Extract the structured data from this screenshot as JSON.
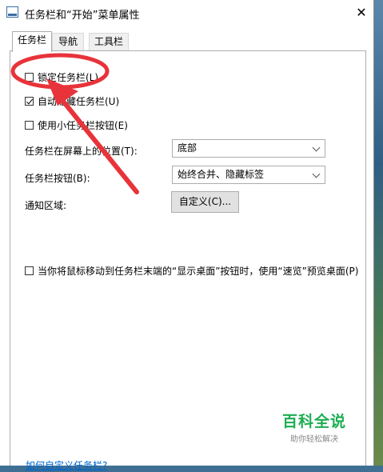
{
  "window": {
    "title": "任务栏和“开始”菜单属性"
  },
  "tabs": [
    {
      "label": "任务栏"
    },
    {
      "label": "导航"
    },
    {
      "label": "工具栏"
    }
  ],
  "options": {
    "lock_taskbar": {
      "label": "锁定任务栏(L)",
      "checked": false
    },
    "auto_hide": {
      "label": "自动隐藏任务栏(U)",
      "checked": true
    },
    "small_buttons": {
      "label": "使用小任务栏按钮(E)",
      "checked": false
    },
    "peek": {
      "label": "当你将鼠标移动到任务栏末端的“显示桌面”按钮时，使用“速览”预览桌面(P)",
      "checked": false
    }
  },
  "position": {
    "label": "任务栏在屏幕上的位置(T):",
    "value": "底部"
  },
  "buttons": {
    "label": "任务栏按钮(B):",
    "value": "始终合并、隐藏标签"
  },
  "notify": {
    "label": "通知区域:",
    "button": "自定义(C)..."
  },
  "help_link": "如何自定义任务栏?",
  "watermark": {
    "main": "百科全说",
    "sub": "助你轻松解决"
  },
  "annotation_color": "#e8333a"
}
